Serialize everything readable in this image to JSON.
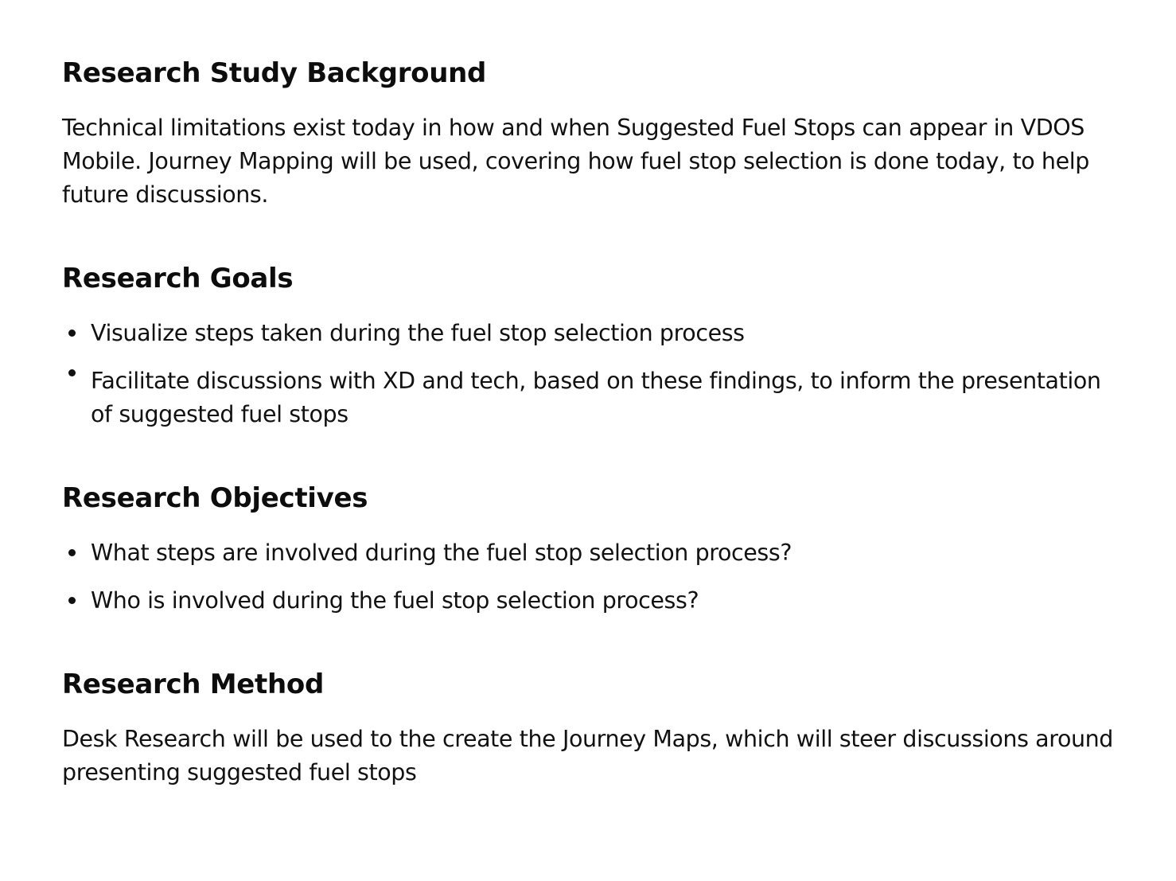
{
  "sections": [
    {
      "heading": "Research Study Background",
      "paragraph": "Technical limitations exist today in how and when Suggested Fuel Stops can appear in VDOS Mobile. Journey Mapping will be used, covering how fuel stop selection is done today, to help future discussions."
    },
    {
      "heading": "Research Goals",
      "bullets": [
        "Visualize steps taken during the fuel stop selection process",
        "Facilitate discussions with XD and tech, based on these findings, to inform the presentation of suggested fuel stops"
      ]
    },
    {
      "heading": "Research Objectives",
      "bullets": [
        "What steps are involved during the fuel stop selection process?",
        "Who is involved during the fuel stop selection process?"
      ]
    },
    {
      "heading": "Research Method",
      "paragraph": "Desk Research will be used to the create the Journey Maps, which will steer discussions around presenting suggested fuel stops"
    }
  ]
}
